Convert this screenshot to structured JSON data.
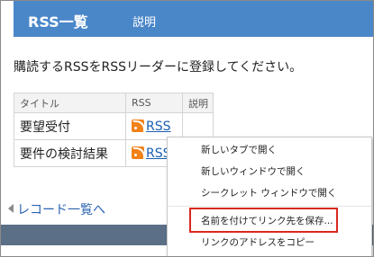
{
  "header": {
    "title": "RSS一覧",
    "subtitle": "説明"
  },
  "intro_text": "購読するRSSをRSSリーダーに登録してください。",
  "table": {
    "columns": [
      "タイトル",
      "RSS",
      "説明"
    ],
    "rows": [
      {
        "title": "要望受付",
        "rss_label": "RSS"
      },
      {
        "title": "要件の検討結果",
        "rss_label": "RSS"
      }
    ]
  },
  "back_link": "レコード一覧へ",
  "context_menu": {
    "items": [
      "新しいタブで開く",
      "新しいウィンドウで開く",
      "シークレット ウィンドウで開く",
      "名前を付けてリンク先を保存...",
      "リンクのアドレスをコピー"
    ],
    "highlighted_index": 3
  },
  "colors": {
    "header_bg": "#4a87c9",
    "rss_icon": "#f2821a",
    "highlight_border": "#d8281e",
    "bottom_bar": "#5b6f86"
  }
}
